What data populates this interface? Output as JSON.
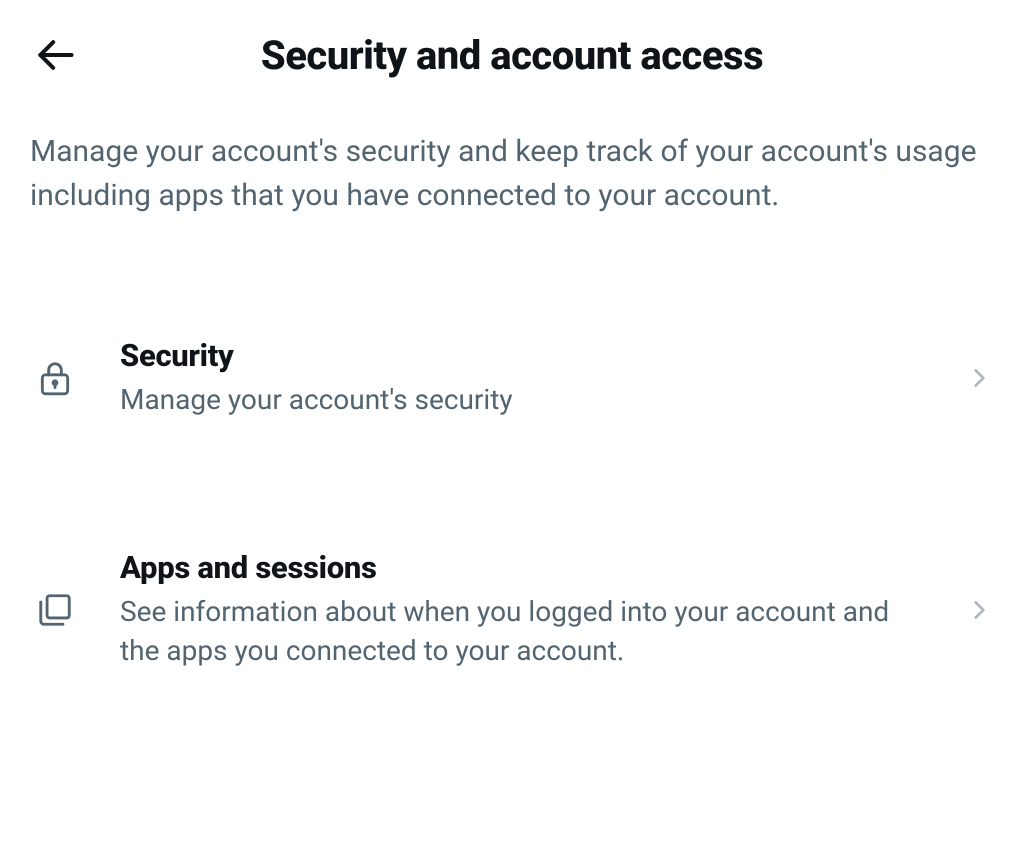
{
  "header": {
    "title": "Security and account access"
  },
  "description": "Manage your account's security and keep track of your account's usage including apps that you have connected to your account.",
  "items": [
    {
      "title": "Security",
      "subtitle": "Manage your account's security"
    },
    {
      "title": "Apps and sessions",
      "subtitle": "See information about when you logged into your account and the apps you connected to your account."
    }
  ]
}
